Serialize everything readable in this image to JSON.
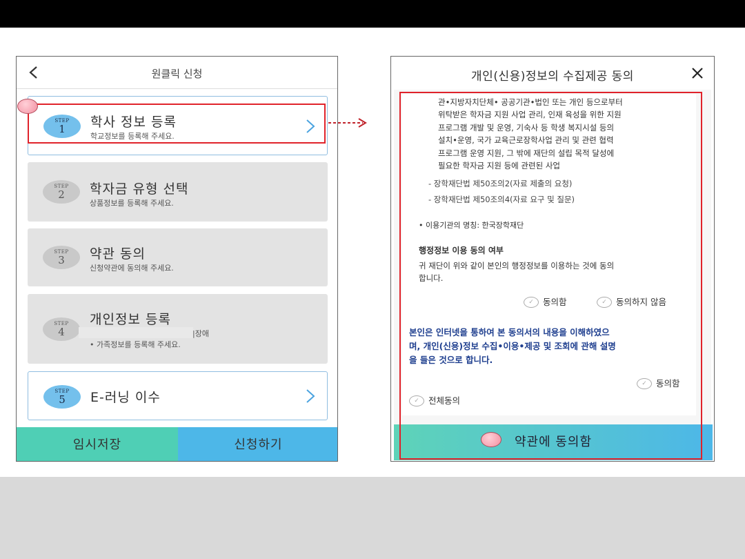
{
  "left_screen": {
    "title": "원클릭 신청",
    "steps": [
      {
        "step_word": "STEP",
        "number": "1",
        "title": "학사 정보 등록",
        "subtitle": "학교정보를 등록해 주세요."
      },
      {
        "step_word": "STEP",
        "number": "2",
        "title": "학자금 유형 선택",
        "subtitle": "상품정보를 등록해 주세요."
      },
      {
        "step_word": "STEP",
        "number": "3",
        "title": "약관 동의",
        "subtitle": "신청약관에 동의해 주세요."
      },
      {
        "step_word": "STEP",
        "number": "4",
        "title": "개인정보 등록",
        "subtitle_partial": "|장애",
        "subtitle2": "• 가족정보를 등록해 주세요."
      },
      {
        "step_word": "STEP",
        "number": "5",
        "title": "E-러닝 이수"
      }
    ],
    "temp_save_label": "임시저장",
    "apply_label": "신청하기"
  },
  "right_screen": {
    "title": "개인(신용)정보의 수집제공 동의",
    "para_lines": [
      "관•지방자치단체• 공공기관•법인 또는 개인 등으로부터",
      "위탁받은 학자금 지원 사업 관리, 인재 육성을 위한 지원",
      "프로그램 개발 및 운영, 기숙사 등 학생 복지시설 등의",
      "설치•운영, 국가 교육근로장학사업 관리 및 관련 협력",
      "프로그램 운영 지원, 그 밖에 재단의 설립 목적 달성에",
      "필요한 학자금 지원 등에 관련된 사업"
    ],
    "law_items": [
      "- 장학재단법 제50조의2(자료 제출의 요청)",
      "- 장학재단법 제50조의4(자료 요구 및 질문)"
    ],
    "institution": "• 이용기관의 명칭: 한국장학재단",
    "admin_heading": "행정정보 이용 동의 여부",
    "admin_text_lines": [
      "귀 재단이 위와 같이 본인의 행정정보를 이용하는 것에 동의",
      "합니다."
    ],
    "agree_label": "동의함",
    "disagree_label": "동의하지 않음",
    "confirm_lines": [
      "본인은 인터넷을 통하여 본 동의서의 내용을 이해하였으",
      "며, 개인(신용)정보 수집•이용•제공 및 조회에 관해 설명",
      "을 들은 것으로 합니다."
    ],
    "confirm_agree_label": "동의함",
    "all_agree_label": "전체동의",
    "agree_button_label": "약관에 동의함"
  },
  "colors": {
    "highlight_red": "#e0222a",
    "step_active_blue": "#74c0ec",
    "temp_save_bg": "#4fcfb5",
    "apply_bg": "#4db7e8",
    "confirm_text_blue": "#1f3f8f"
  }
}
